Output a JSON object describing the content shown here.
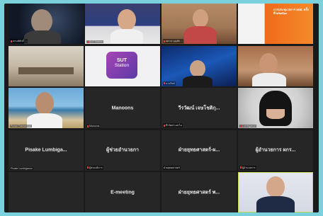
{
  "meeting": {
    "tiles": [
      {
        "label": "ณรงค์ศักดิ์ ...",
        "display_name": "",
        "video": "space"
      },
      {
        "label": "SUT Station",
        "display_name": "",
        "video": "office"
      },
      {
        "label": "ผศ.ดร.บุญชัย ...",
        "display_name": "",
        "video": "room"
      },
      {
        "label": "",
        "display_name": "",
        "video": "orange-poster"
      },
      {
        "label": "",
        "display_name": "",
        "video": "meeting-room"
      },
      {
        "label": "",
        "display_name": "",
        "video": "sut-logo"
      },
      {
        "label": "นายวิทย์",
        "display_name": "",
        "video": "blue-studio"
      },
      {
        "label": "",
        "display_name": "",
        "video": "home"
      },
      {
        "label": "Pichai Thanomsak",
        "display_name": "",
        "video": "beach"
      },
      {
        "label": "Manoons",
        "display_name": "Manoons",
        "video": "none"
      },
      {
        "label": "ธีรวัฒน์ เอส.ไอ",
        "display_name": "วีรวัฒน์ เจษโชติกุ...",
        "video": "none"
      },
      {
        "label": "Lumbiganon",
        "display_name": "",
        "video": "batman"
      },
      {
        "label": "Pisake Lumbiganon",
        "display_name": "Pisake Lumbiga...",
        "video": "none"
      },
      {
        "label": "ผู้ช่วยอธิการ",
        "display_name": "ผู้ช่วยอำนวยกา",
        "video": "none"
      },
      {
        "label": "ฝ่ายยุทธศาสตร์",
        "display_name": "ฝ่ายยุทธศาสตร์-ผ...",
        "video": "none"
      },
      {
        "label": "ผู้อำนวยการ",
        "display_name": "ผู้อำนวยการ ผกร...",
        "video": "none"
      },
      {
        "label": "",
        "display_name": "",
        "video": "none"
      },
      {
        "label": "",
        "display_name": "E-meeting",
        "video": "none"
      },
      {
        "label": "",
        "display_name": "ฝ่ายยุทธศาสตร์ พ...",
        "video": "none"
      },
      {
        "label": "",
        "display_name": "",
        "video": "portrait",
        "active": true
      }
    ],
    "poster_text": "การประชุม สภาฯ มทส. ครั้งที่ ๒/๒๕๖๓",
    "logo": {
      "line1": "SUT",
      "line2": "Station"
    },
    "colors": {
      "active_border": "#c9d84a",
      "mic_muted": "#e03a3a",
      "background": "#7ad1dc"
    }
  }
}
